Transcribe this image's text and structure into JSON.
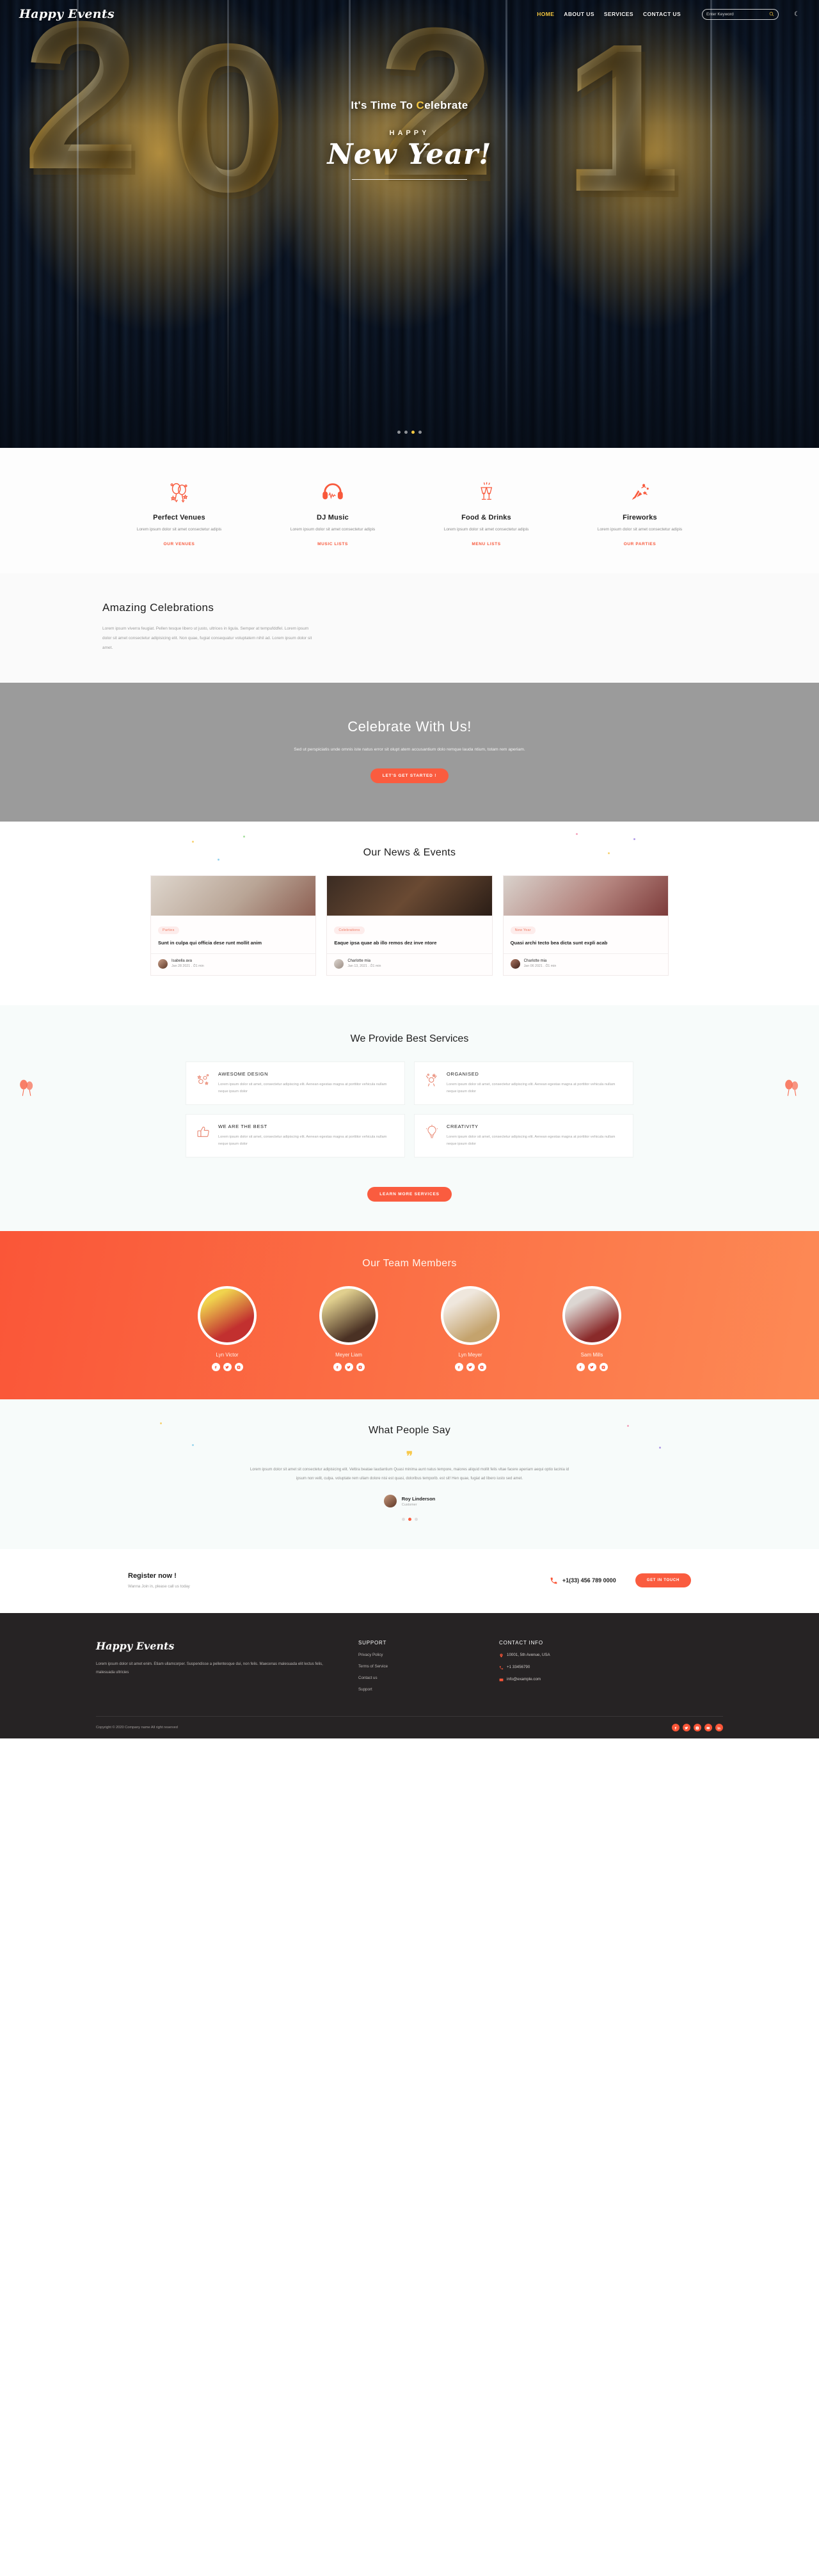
{
  "site": {
    "brand": "Happy Events"
  },
  "nav": {
    "links": [
      {
        "label": "HOME",
        "active": true
      },
      {
        "label": "ABOUT US",
        "active": false
      },
      {
        "label": "SERVICES",
        "active": false
      },
      {
        "label": "CONTACT US",
        "active": false
      }
    ],
    "search_placeholder": "Enter Keyword",
    "search_value": "",
    "search_icon": "search-icon",
    "theme_icon": "moon-icon"
  },
  "hero": {
    "kicker_pre": "It's Time To ",
    "kicker_accent": "C",
    "kicker_post": "elebrate",
    "happy": "HAPPY",
    "script": "New Year!",
    "balloon_digits": [
      "2",
      "0",
      "2",
      "1"
    ],
    "slide_count": 4,
    "active_slide": 2
  },
  "features": [
    {
      "icon": "balloons-icon",
      "title": "Perfect Venues",
      "desc": "Lorem ipsum dolor sit amet consectetur adipis",
      "link": "OUR VENUES"
    },
    {
      "icon": "headphones-icon",
      "title": "DJ Music",
      "desc": "Lorem ipsum dolor sit amet consectetur adipis",
      "link": "MUSIC LISTS"
    },
    {
      "icon": "champagne-glasses-icon",
      "title": "Food & Drinks",
      "desc": "Lorem ipsum dolor sit amet consectetur adipis",
      "link": "MENU LISTS"
    },
    {
      "icon": "party-popper-icon",
      "title": "Fireworks",
      "desc": "Lorem ipsum dolor sit amet consectetur adipis",
      "link": "OUR PARTIES"
    }
  ],
  "amazing": {
    "title": "Amazing Celebrations",
    "body": "Lorem ipsum viverra feugiat. Pellen tesque libero ut justo, ultrices in ligula. Semper at tempufddfel. Lorem ipsum dolor sit amet consectetur adipisicing elit. Non quae, fugiat consequatur voluptatem nihil ad. Lorem ipsum dolor sit amet."
  },
  "celebrate": {
    "title": "Celebrate With Us!",
    "body": "Sed ut perspiciatis unde omnis iste natus error sit olupt atem accusantium dolo remque lauda ntium, totam rem aperiam.",
    "button": "LET'S GET STARTED !"
  },
  "news": {
    "title": "Our News & Events",
    "cards": [
      {
        "tag": "Parties",
        "title": "Sunt in culpa qui officia dese runt mollit anim",
        "author": "Isabella ava",
        "date": "Jan 28 2021",
        "read": "1 min"
      },
      {
        "tag": "Celebrations",
        "title": "Eaque ipsa quae ab illo remos dez inve ntore",
        "author": "Charlotte mia",
        "date": "Jan 13, 2021",
        "read": "1 min"
      },
      {
        "tag": "New Year",
        "title": "Quasi archi tecto bea dicta sunt expli acab",
        "author": "Charlotte mia",
        "date": "Jan 06 2021",
        "read": "1 min"
      }
    ]
  },
  "services": {
    "title": "We Provide Best Services",
    "items": [
      {
        "icon": "confetti-stars-icon",
        "title": "AWESOME DESIGN",
        "desc": "Lorem ipsum dolor sit amet, consectetur adipiscing elit. Aenean egestas magna at porttitor vehicula nullam neque ipsum dolor"
      },
      {
        "icon": "celebrating-person-icon",
        "title": "ORGANISED",
        "desc": "Lorem ipsum dolor sit amet, consectetur adipiscing elit. Aenean egestas magna at porttitor vehicula nullam neque ipsum dolor"
      },
      {
        "icon": "thumbs-up-icon",
        "title": "WE ARE THE BEST",
        "desc": "Lorem ipsum dolor sit amet, consectetur adipiscing elit. Aenean egestas magna at porttitor vehicula nullam neque ipsum dolor"
      },
      {
        "icon": "lightbulb-idea-icon",
        "title": "CREATIVITY",
        "desc": "Lorem ipsum dolor sit amet, consectetur adipiscing elit. Aenean egestas magna at porttitor vehicula nullam neque ipsum dolor"
      }
    ],
    "button": "LEARN MORE SERVICES"
  },
  "team": {
    "title": "Our Team Members",
    "members": [
      {
        "name": "Lyn Victor",
        "socials": [
          "facebook-icon",
          "twitter-icon",
          "instagram-icon"
        ]
      },
      {
        "name": "Meyer Liam",
        "socials": [
          "facebook-icon",
          "twitter-icon",
          "instagram-icon"
        ]
      },
      {
        "name": "Lyn Meyer",
        "socials": [
          "facebook-icon",
          "twitter-icon",
          "instagram-icon"
        ]
      },
      {
        "name": "Sam Mills",
        "socials": [
          "facebook-icon",
          "twitter-icon",
          "instagram-icon"
        ]
      }
    ]
  },
  "testimonial": {
    "title": "What People Say",
    "quote_glyph": "❞",
    "quote": "Lorem ipsum dolor sit amet sit consectetur adipisicing elit. Veltira beatae laudantium Quasi minima aunt natus tempore, maiores aliquid mollit felis vitae facere aperiam aequi optio lacinia id ipsum non velit, culpa. voluptate rem ullam dolore nisi est quasi, doloribus temporib. est sit! Hen quae, fugiat ad libero iusto sed amet.",
    "name": "Roy Linderson",
    "role": "Customer",
    "dot_count": 3,
    "active_dot": 1
  },
  "register": {
    "title": "Register now !",
    "sub": "Wanna Join in, please call us today",
    "phone_icon": "phone-icon",
    "phone": "+1(33) 456 789 0000",
    "button": "GET IN TOUCH"
  },
  "footer": {
    "brand": "Happy Events",
    "about": "Lorem ipsum dolor sit amet enim. Etiam ullamcorper. Suspendisse a pellentesque dui, non felis. Maecenas malesuada elit lectus felis, malesuada ultricies",
    "support_heading": "SUPPORT",
    "support_links": [
      "Privacy Policy",
      "Terms of Service",
      "Contact us",
      "Support"
    ],
    "contact_heading": "CONTACT INFO",
    "contact": [
      {
        "icon": "location-pin-icon",
        "text": "10001, 5th Avenue, USA"
      },
      {
        "icon": "phone-icon",
        "text": "+1 33456790"
      },
      {
        "icon": "mail-icon",
        "text": "info@example.com"
      }
    ],
    "copyright": "Copyright © 2020 Company name All right reserved",
    "socials": [
      "facebook-icon",
      "twitter-icon",
      "instagram-icon",
      "youtube-icon",
      "linkedin-icon"
    ]
  },
  "colors": {
    "accent": "#fa5c3f",
    "gold": "#f5c842",
    "dark": "#262324"
  }
}
